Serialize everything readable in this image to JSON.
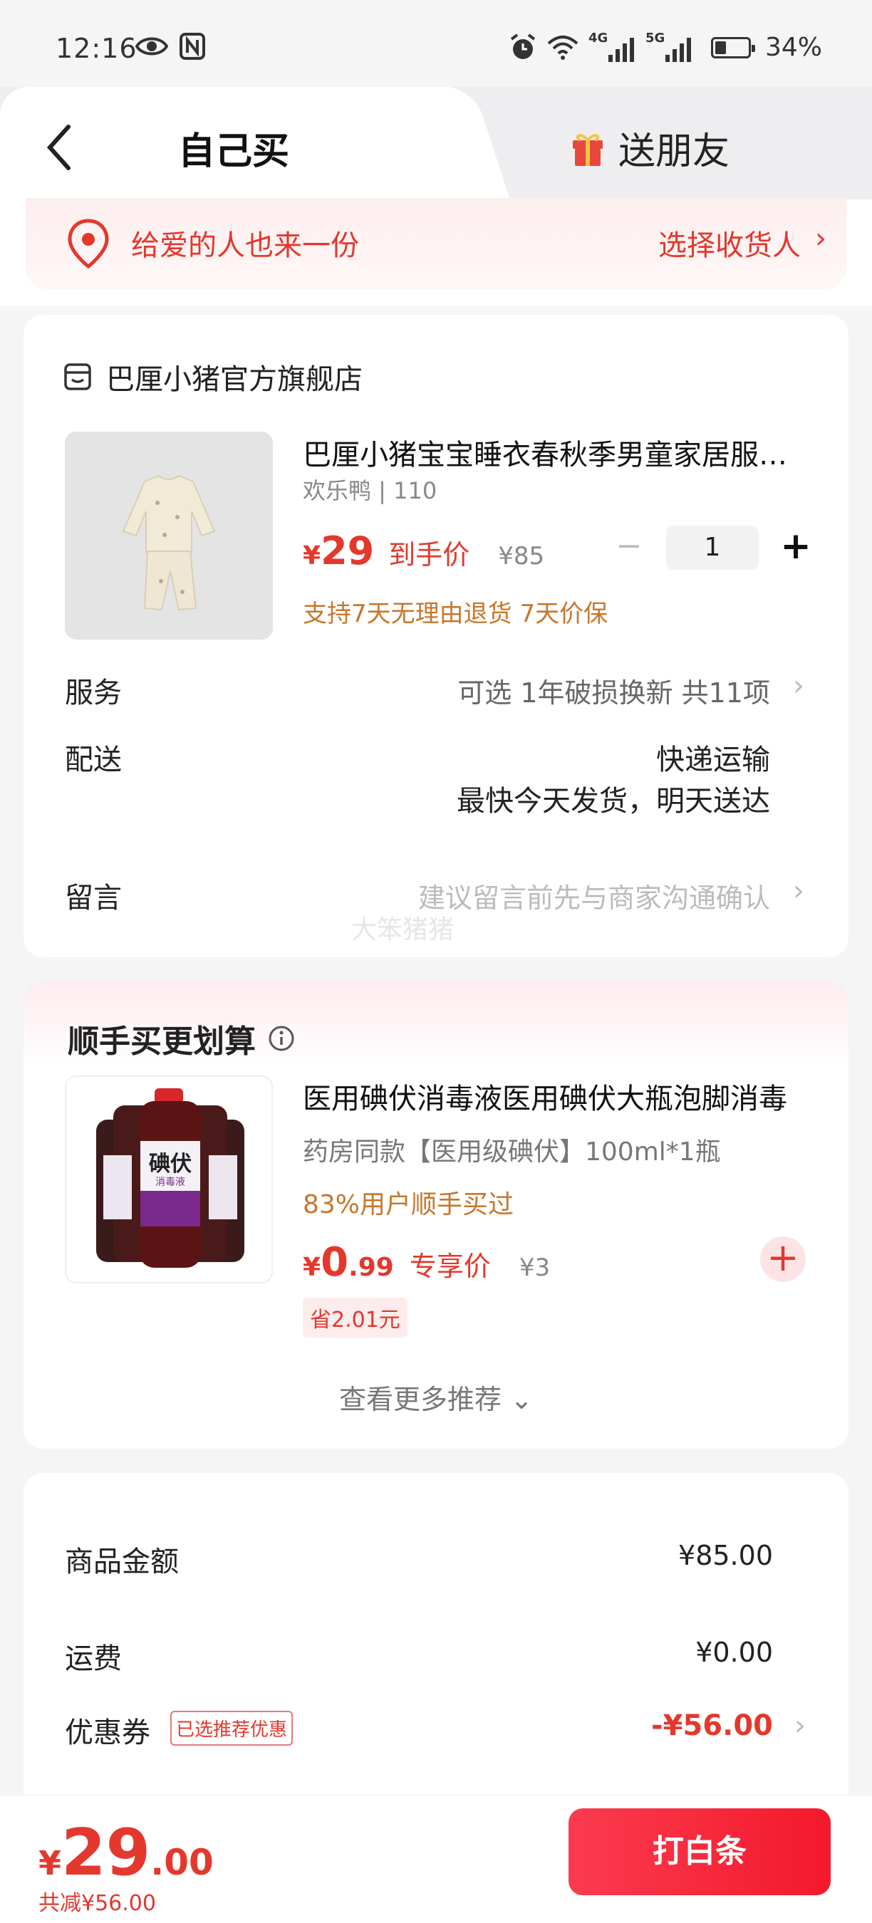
{
  "status_bar": {
    "time": "12:16",
    "battery_text": "34%",
    "battery_level": 0.34,
    "net_1": "4G",
    "net_2": "5G"
  },
  "tabs": {
    "self": "自己买",
    "gift": "送朋友"
  },
  "address_banner": {
    "text": "给爱的人也来一份",
    "action": "选择收货人",
    "chevron": "›"
  },
  "order": {
    "shop_name": "巴厘小猪官方旗舰店",
    "product_title": "巴厘小猪宝宝睡衣春秋季男童家居服套装",
    "product_spec": "欢乐鸭 | 110",
    "currency": "¥",
    "price": "29",
    "price_tag": "到手价",
    "original_price": "¥85",
    "quantity": "1",
    "minus": "−",
    "plus": "+",
    "guarantee": "支持7天无理由退货 7天价保",
    "service_label": "服务",
    "service_value": "可选 1年破损换新 共11项",
    "shipping_label": "配送",
    "shipping_method": "快递运输",
    "shipping_time": "最快今天发货，明天送达",
    "message_label": "留言",
    "message_placeholder": "建议留言前先与商家沟通确认",
    "watermark": "大笨猪猪",
    "chevron": "›"
  },
  "addon": {
    "title": "顺手买更划算",
    "product_name": "医用碘伏消毒液医用碘伏大瓶泡脚消毒",
    "product_desc": "药房同款【医用级碘伏】100ml*1瓶",
    "social_proof": "83%用户顺手买过",
    "currency": "¥",
    "price_int": "0",
    "price_dec": ".99",
    "price_tag": "专享价",
    "original_price": "¥3",
    "saving": "省2.01元",
    "add_symbol": "+",
    "more_label": "查看更多推荐",
    "more_chevron": "⌄",
    "bottle_label": "碘伏",
    "bottle_sub": "消毒液"
  },
  "summary": {
    "goods_label": "商品金额",
    "goods_value": "¥85.00",
    "shipping_label": "运费",
    "shipping_value": "¥0.00",
    "coupon_label": "优惠券",
    "coupon_badge": "已选推荐优惠",
    "coupon_value": "-¥56.00",
    "chevron": "›"
  },
  "bottom_bar": {
    "currency": "¥",
    "total_int": "29",
    "total_dec": ".00",
    "discount": "共减¥56.00",
    "pay_label": "打白条"
  },
  "colors": {
    "accent": "#e3382d",
    "price_orange": "#c8762b",
    "button_red": "#f3192b"
  }
}
